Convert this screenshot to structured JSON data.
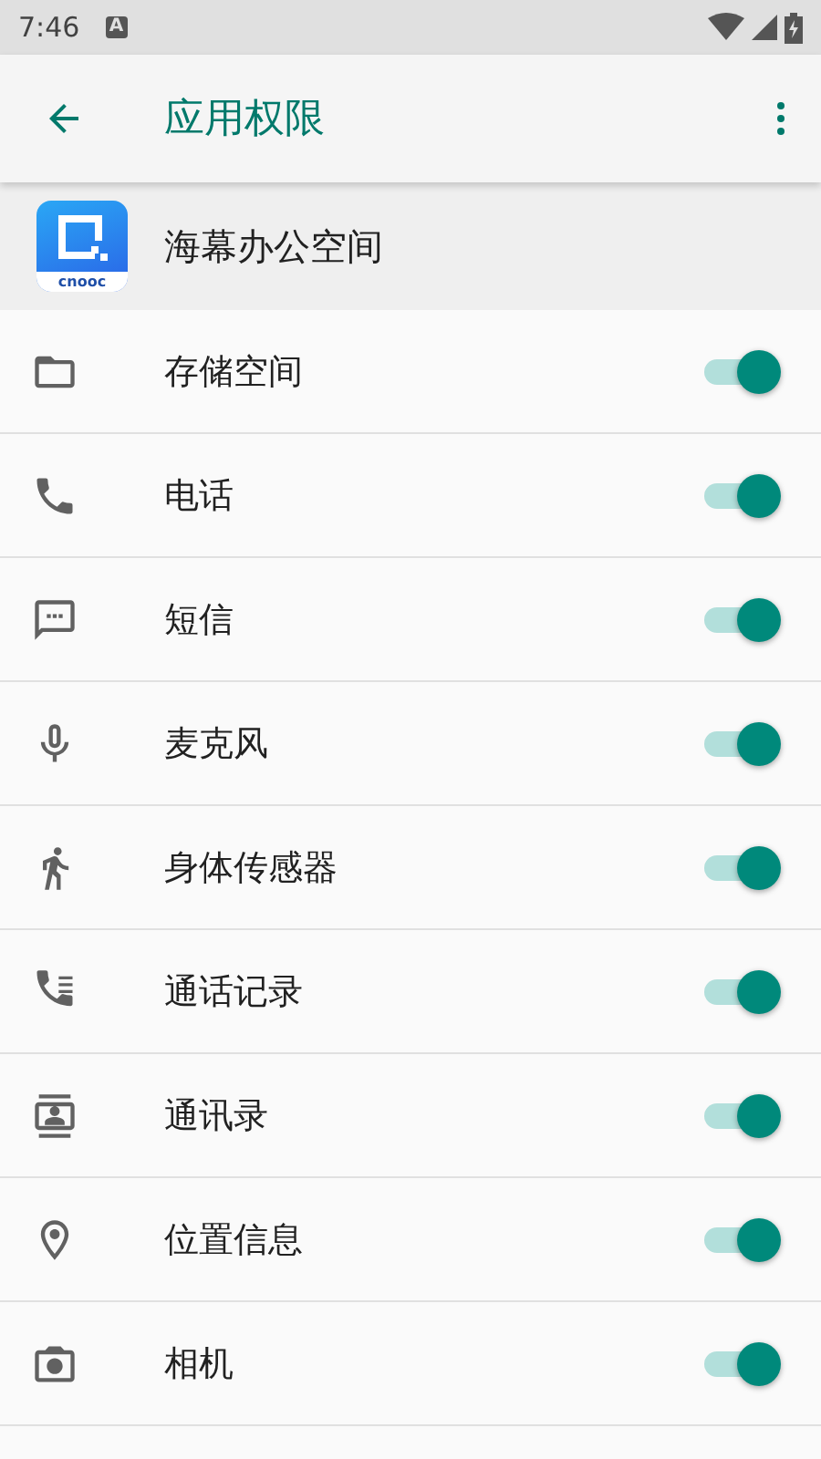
{
  "status_bar": {
    "time": "7:46",
    "notification_glyph": "A"
  },
  "toolbar": {
    "title": "应用权限"
  },
  "app": {
    "name": "海幕办公空间",
    "logo_text": "cnooc"
  },
  "permissions": [
    {
      "kind": "storage",
      "label": "存储空间",
      "on": true
    },
    {
      "kind": "phone",
      "label": "电话",
      "on": true
    },
    {
      "kind": "sms",
      "label": "短信",
      "on": true
    },
    {
      "kind": "microphone",
      "label": "麦克风",
      "on": true
    },
    {
      "kind": "sensors",
      "label": "身体传感器",
      "on": true
    },
    {
      "kind": "call_log",
      "label": "通话记录",
      "on": true
    },
    {
      "kind": "contacts",
      "label": "通讯录",
      "on": true
    },
    {
      "kind": "location",
      "label": "位置信息",
      "on": true
    },
    {
      "kind": "camera",
      "label": "相机",
      "on": true
    }
  ]
}
